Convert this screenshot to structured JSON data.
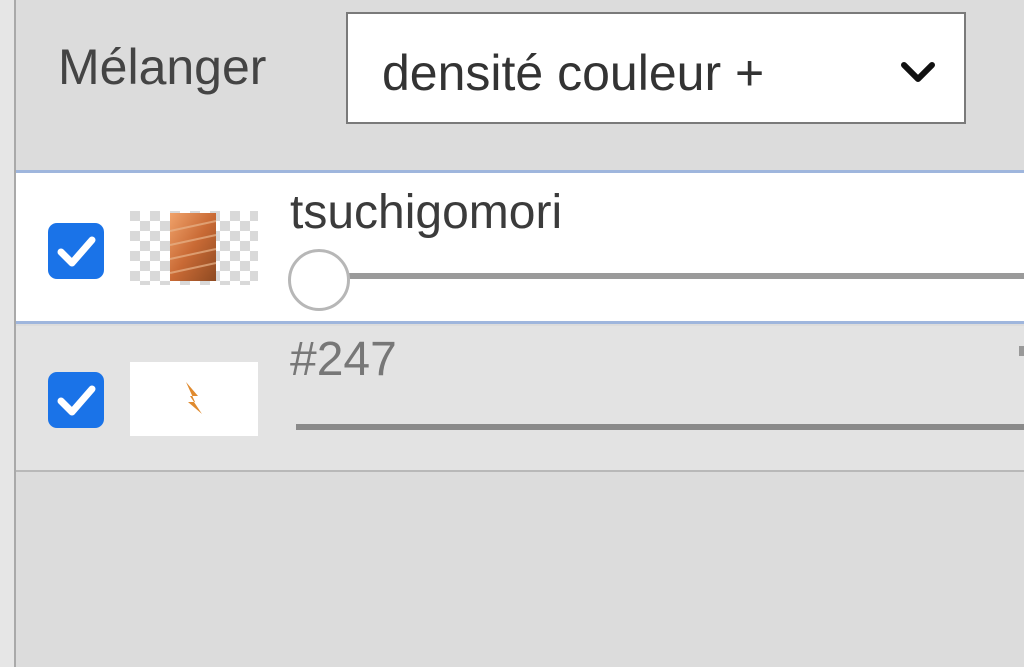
{
  "blend": {
    "label": "Mélanger",
    "selected_option": "densité couleur +"
  },
  "layers": [
    {
      "name": "tsuchigomori",
      "visible": true,
      "opacity_fraction": 0.0,
      "active": true
    },
    {
      "name": "#247",
      "visible": true,
      "active": false
    }
  ],
  "colors": {
    "checkbox_accent": "#1a73e8",
    "active_layer_border": "#9fb6dd",
    "panel_background": "#dcdcdc"
  },
  "icons": [
    "chevron-down-icon",
    "checkmark-icon",
    "layer-thumbnail"
  ]
}
